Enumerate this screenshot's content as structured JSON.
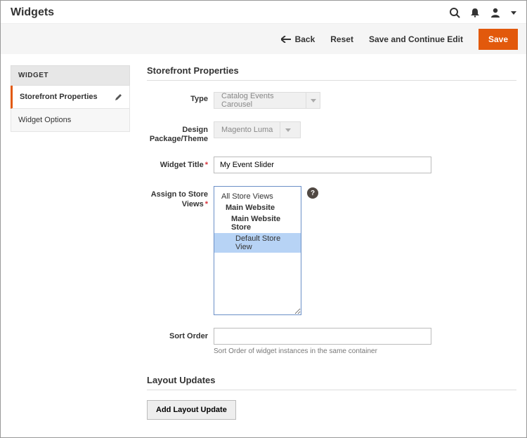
{
  "header": {
    "title": "Widgets"
  },
  "toolbar": {
    "back": "Back",
    "reset": "Reset",
    "save_continue": "Save and Continue Edit",
    "save": "Save"
  },
  "sidebar": {
    "heading": "WIDGET",
    "items": [
      {
        "label": "Storefront Properties"
      },
      {
        "label": "Widget Options"
      }
    ]
  },
  "section": {
    "storefront_title": "Storefront Properties",
    "layout_title": "Layout Updates"
  },
  "fields": {
    "type_label": "Type",
    "type_value": "Catalog Events Carousel",
    "theme_label": "Design Package/Theme",
    "theme_value": "Magento Luma",
    "title_label": "Widget Title",
    "title_value": "My Event Slider",
    "stores_label": "Assign to Store Views",
    "sort_label": "Sort Order",
    "sort_value": "",
    "sort_hint": "Sort Order of widget instances in the same container"
  },
  "stores": {
    "all": "All Store Views",
    "website": "Main Website",
    "store": "Main Website Store",
    "view": "Default Store View"
  },
  "buttons": {
    "add_layout": "Add Layout Update"
  }
}
